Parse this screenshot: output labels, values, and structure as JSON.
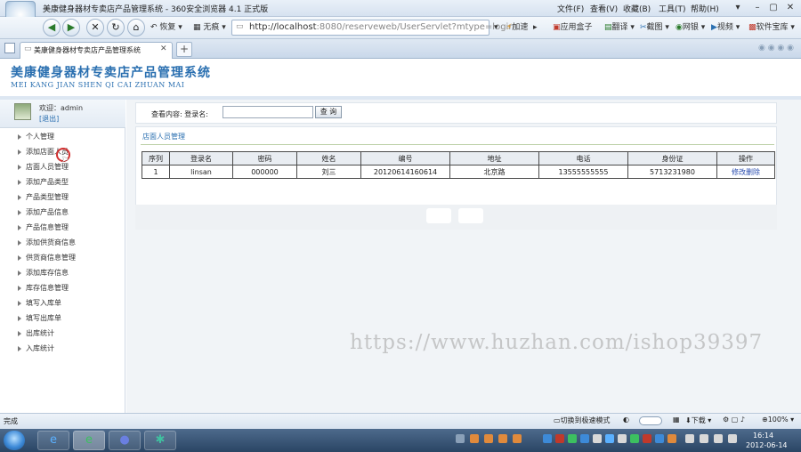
{
  "browser": {
    "window_title": "美康健身器材专卖店产品管理系统 - 360安全浏览器 4.1 正式版",
    "menu": [
      "文件(F)",
      "查看(V)",
      "收藏(B)",
      "工具(T)",
      "帮助(H)"
    ],
    "toolbar": {
      "restore": "恢复",
      "trace_free": "无痕",
      "address_host": "http://localhost",
      "address_rest": ":8080/reserveweb/UserServlet?mtype=login",
      "accelerate": "加速",
      "app_box": "应用盒子",
      "translate": "翻译",
      "screenshot": "截图",
      "bank": "网银",
      "video": "视频",
      "software": "软件宝库"
    },
    "tab_title": "美康健身器材专卖店产品管理系统",
    "status": {
      "left_text": "完成",
      "mode": "切换到极速模式",
      "download": "下载",
      "zoom": "100%"
    }
  },
  "app": {
    "title": "美康健身器材专卖店产品管理系统",
    "subtitle": "MEI KANG JIAN SHEN QI CAI ZHUAN MAI",
    "user": {
      "welcome": "欢迎：admin",
      "logout": "[退出]"
    },
    "nav": [
      "个人管理",
      "添加店面人员",
      "店面人员管理",
      "添加产品类型",
      "产品类型管理",
      "添加产品信息",
      "产品信息管理",
      "添加供货商信息",
      "供货商信息管理",
      "添加库存信息",
      "库存信息管理",
      "填写入库单",
      "填写出库单",
      "出库统计",
      "入库统计"
    ],
    "search": {
      "label": "查看内容:  登录名:",
      "value": "",
      "button": "查 询"
    },
    "list_title": "店面人员管理",
    "table": {
      "headers": [
        "序列",
        "登录名",
        "密码",
        "姓名",
        "编号",
        "地址",
        "电话",
        "身份证",
        "操作"
      ],
      "rows": [
        [
          "1",
          "linsan",
          "000000",
          "刘三",
          "20120614160614",
          "北京路",
          "13555555555",
          "5713231980",
          "修改删除"
        ]
      ]
    },
    "watermark": "https://www.huzhan.com/ishop39397"
  },
  "taskbar": {
    "time": "16:14",
    "date": "2012-06-14"
  },
  "colors": {
    "accent": "#2a6fb0",
    "taskbar": "#2a4564",
    "marker": "#d23030"
  }
}
